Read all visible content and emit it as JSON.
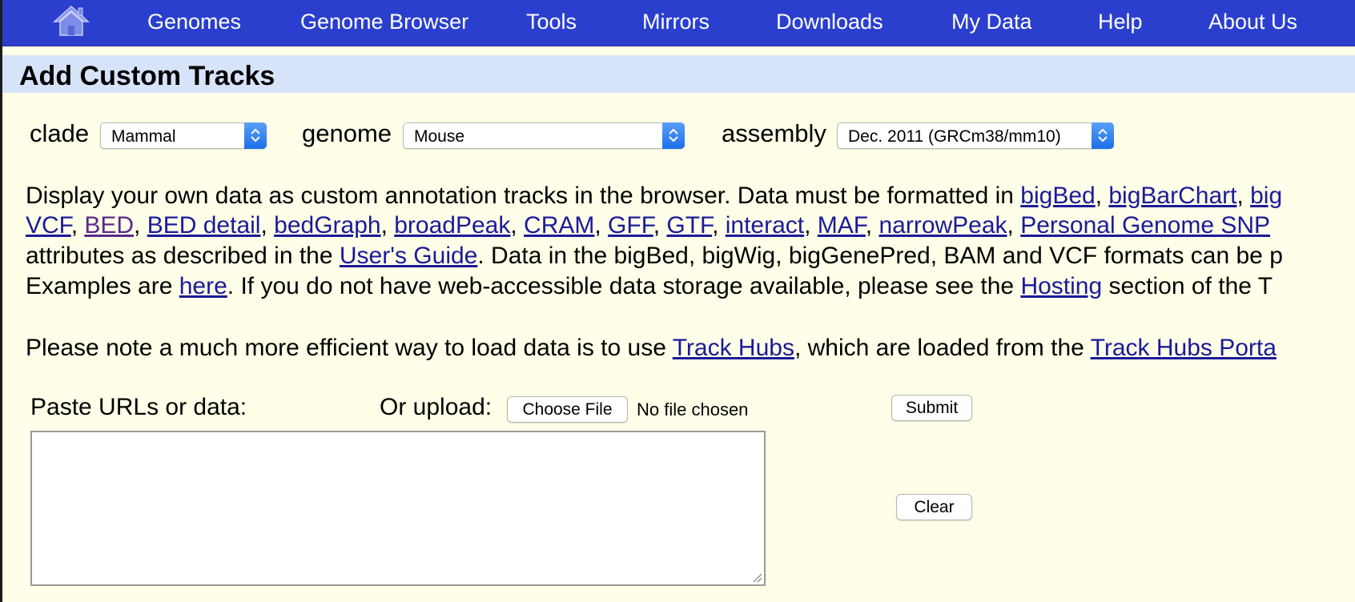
{
  "nav": {
    "home_icon": "home-icon",
    "items": [
      "Genomes",
      "Genome Browser",
      "Tools",
      "Mirrors",
      "Downloads",
      "My Data",
      "Help",
      "About Us"
    ]
  },
  "page": {
    "title": "Add Custom Tracks"
  },
  "selectors": {
    "clade": {
      "label": "clade",
      "value": "Mammal"
    },
    "genome": {
      "label": "genome",
      "value": "Mouse"
    },
    "assembly": {
      "label": "assembly",
      "value": "Dec. 2011 (GRCm38/mm10)"
    }
  },
  "description": {
    "line1": {
      "t1": "Display your own data as custom annotation tracks in the browser. Data must be formatted in ",
      "l1": "bigBed",
      "t2": ", ",
      "l2": "bigBarChart",
      "t3": ", ",
      "l3": "big"
    },
    "line2": {
      "l1": "VCF",
      "s1": ", ",
      "l2": "BED",
      "s2": ", ",
      "l3": "BED detail",
      "s3": ", ",
      "l4": "bedGraph",
      "s4": ", ",
      "l5": "broadPeak",
      "s5": ", ",
      "l6": "CRAM",
      "s6": ", ",
      "l7": "GFF",
      "s7": ", ",
      "l8": "GTF",
      "s8": ", ",
      "l9": "interact",
      "s9": ", ",
      "l10": "MAF",
      "s10": ", ",
      "l11": "narrowPeak",
      "s11": ", ",
      "l12": "Personal Genome SNP"
    },
    "line3": {
      "t1": "attributes as described in the ",
      "l1": "User's Guide",
      "t2": ". Data in the bigBed, bigWig, bigGenePred, BAM and VCF formats can be p"
    },
    "line4": {
      "t1": "Examples are ",
      "l1": "here",
      "t2": ". If you do not have web-accessible data storage available, please see the ",
      "l2": "Hosting",
      "t3": " section of the T"
    },
    "line5": {
      "t1": "Please note a much more efficient way to load data is to use ",
      "l1": "Track Hubs",
      "t2": ", which are loaded from the ",
      "l2": "Track Hubs Porta"
    }
  },
  "form": {
    "paste_label": "Paste URLs or data:",
    "upload_label": "Or upload:",
    "choose_file": "Choose File",
    "no_file": "No file chosen",
    "submit": "Submit",
    "clear": "Clear",
    "textarea_value": ""
  },
  "colors": {
    "nav_bg": "#2b3fce",
    "title_bar_bg": "#d7e3f8",
    "page_bg": "#fffee8",
    "link": "#1a1a9a"
  }
}
